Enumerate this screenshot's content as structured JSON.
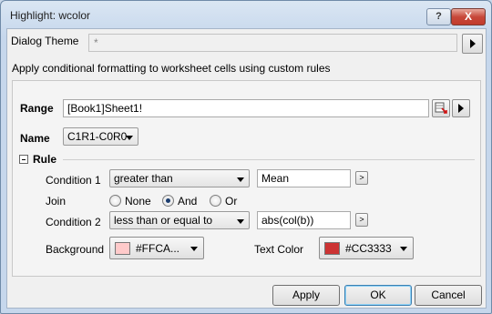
{
  "window": {
    "title": "Highlight: wcolor",
    "help_glyph": "?",
    "close_glyph": "X"
  },
  "theme": {
    "label": "Dialog Theme",
    "value": "*"
  },
  "description": "Apply conditional formatting to worksheet cells using custom rules",
  "range": {
    "label": "Range",
    "value": "[Book1]Sheet1!"
  },
  "name": {
    "label": "Name",
    "value": "C1R1-C0R0"
  },
  "rule": {
    "label": "Rule",
    "condition1": {
      "label": "Condition 1",
      "operator": "greater than",
      "value": "Mean",
      "button": ">"
    },
    "join": {
      "label": "Join",
      "options": [
        "None",
        "And",
        "Or"
      ],
      "selected": "And"
    },
    "condition2": {
      "label": "Condition 2",
      "operator": "less than or equal to",
      "value": "abs(col(b))",
      "button": ">"
    },
    "background": {
      "label": "Background",
      "color_text": "#FFCA...",
      "color": "#FFCACA"
    },
    "text_color": {
      "label": "Text Color",
      "color_text": "#CC3333",
      "color": "#CC3333"
    }
  },
  "buttons": {
    "apply": "Apply",
    "ok": "OK",
    "cancel": "Cancel"
  }
}
